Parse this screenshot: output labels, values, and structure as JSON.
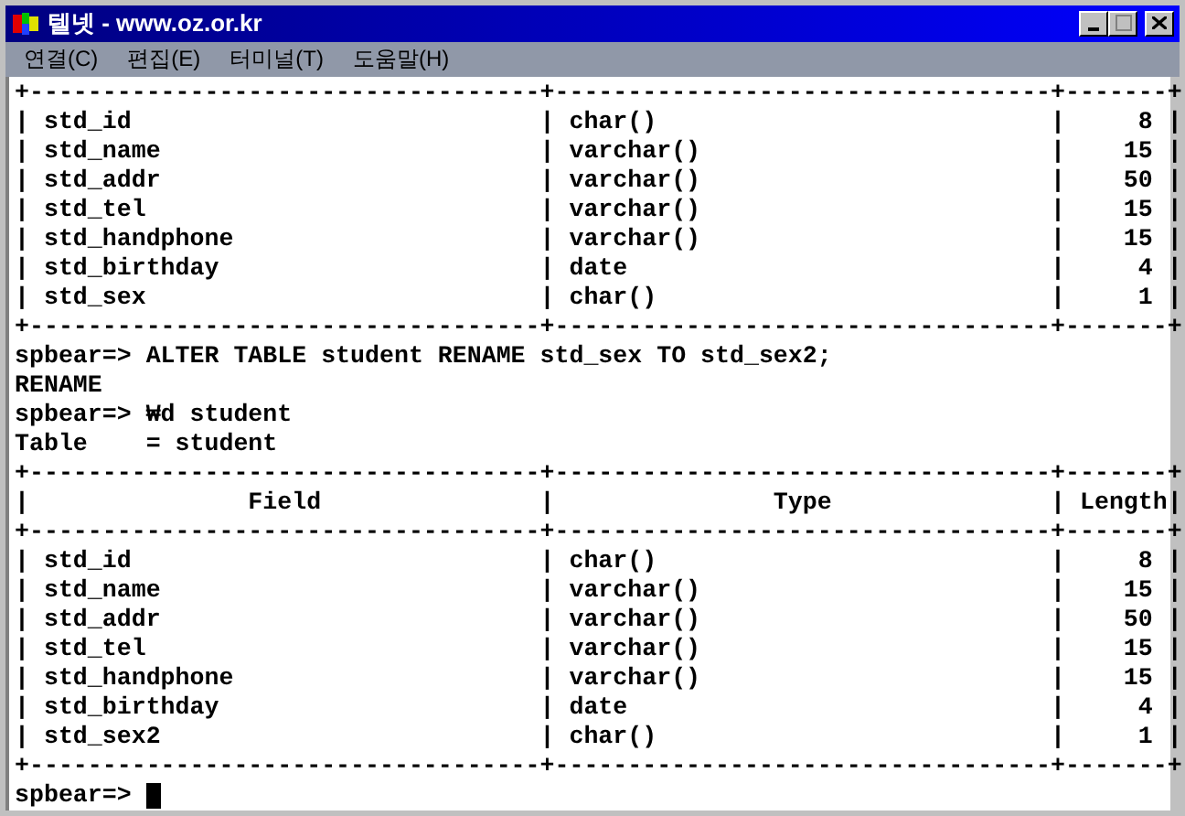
{
  "window": {
    "title": "텔넷 - www.oz.or.kr"
  },
  "menu": [
    {
      "label": "연결(C)"
    },
    {
      "label": "편집(E)"
    },
    {
      "label": "터미널(T)"
    },
    {
      "label": "도움말(H)"
    }
  ],
  "terminal": {
    "lines": [
      "+-----------------------------------+----------------------------------+-------+",
      "| std_id                            | char()                           |     8 |",
      "| std_name                          | varchar()                        |    15 |",
      "| std_addr                          | varchar()                        |    50 |",
      "| std_tel                           | varchar()                        |    15 |",
      "| std_handphone                     | varchar()                        |    15 |",
      "| std_birthday                      | date                             |     4 |",
      "| std_sex                           | char()                           |     1 |",
      "+-----------------------------------+----------------------------------+-------+",
      "spbear=> ALTER TABLE student RENAME std_sex TO std_sex2;",
      "RENAME",
      "spbear=> ₩d student",
      "Table    = student",
      "+-----------------------------------+----------------------------------+-------+",
      "|               Field               |               Type               | Length|",
      "+-----------------------------------+----------------------------------+-------+",
      "| std_id                            | char()                           |     8 |",
      "| std_name                          | varchar()                        |    15 |",
      "| std_addr                          | varchar()                        |    50 |",
      "| std_tel                           | varchar()                        |    15 |",
      "| std_handphone                     | varchar()                        |    15 |",
      "| std_birthday                      | date                             |     4 |",
      "| std_sex2                          | char()                           |     1 |",
      "+-----------------------------------+----------------------------------+-------+"
    ],
    "prompt": "spbear=>"
  }
}
